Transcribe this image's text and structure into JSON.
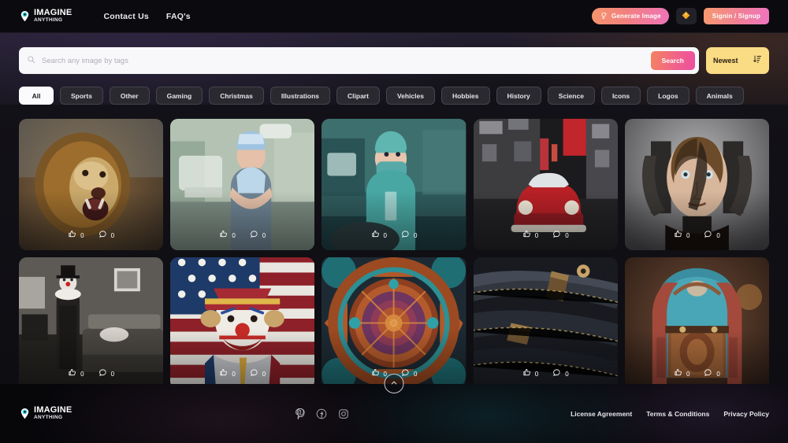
{
  "header": {
    "logo": {
      "icon": "lightbulb-pin-icon",
      "top": "IMAGINE",
      "bottom": "ANYTHING",
      "accent": "#3fd6e0"
    },
    "nav": [
      {
        "label": "Contact Us",
        "name": "nav-contact-us"
      },
      {
        "label": "FAQ's",
        "name": "nav-faqs"
      }
    ],
    "generate_button": {
      "label": "Generate Image",
      "icon": "magic-lightbulb-icon"
    },
    "coin_button": {
      "icon": "coin-icon"
    },
    "signin_button": {
      "label": "Signin / Signup"
    }
  },
  "search": {
    "placeholder": "Search any image by tags",
    "value": "",
    "icon": "search-icon",
    "button_label": "Search",
    "sort": {
      "value": "Newest",
      "icon": "sort-descending-icon"
    }
  },
  "categories": [
    {
      "label": "All",
      "active": true
    },
    {
      "label": "Sports",
      "active": false
    },
    {
      "label": "Other",
      "active": false
    },
    {
      "label": "Gaming",
      "active": false
    },
    {
      "label": "Christmas",
      "active": false
    },
    {
      "label": "Illustrations",
      "active": false
    },
    {
      "label": "Clipart",
      "active": false
    },
    {
      "label": "Vehicles",
      "active": false
    },
    {
      "label": "Hobbies",
      "active": false
    },
    {
      "label": "History",
      "active": false
    },
    {
      "label": "Science",
      "active": false
    },
    {
      "label": "Icons",
      "active": false
    },
    {
      "label": "Logos",
      "active": false
    },
    {
      "label": "Animals",
      "active": false
    }
  ],
  "gallery": {
    "like_icon": "thumbs-up-icon",
    "comment_icon": "comment-bubble-icon",
    "items": [
      {
        "subject": "roaring lion",
        "likes": "0",
        "comments": "0"
      },
      {
        "subject": "nurse in operating room",
        "likes": "0",
        "comments": "0"
      },
      {
        "subject": "surgeon in teal scrubs",
        "likes": "0",
        "comments": "0"
      },
      {
        "subject": "red classic car on street",
        "likes": "0",
        "comments": "0"
      },
      {
        "subject": "cyborg woman portrait",
        "likes": "0",
        "comments": "0"
      },
      {
        "subject": "clown in bedroom black and white",
        "likes": "0",
        "comments": "0"
      },
      {
        "subject": "clown with american flag",
        "likes": "0",
        "comments": "0"
      },
      {
        "subject": "ornate mandala pattern",
        "likes": "0",
        "comments": "0"
      },
      {
        "subject": "rolled denim jeans",
        "likes": "0",
        "comments": "0"
      },
      {
        "subject": "teal and red backpack",
        "likes": "0",
        "comments": "0"
      }
    ]
  },
  "footer": {
    "logo": {
      "top": "IMAGINE",
      "bottom": "ANYTHING"
    },
    "social": [
      {
        "name": "pinterest-icon"
      },
      {
        "name": "facebook-icon"
      },
      {
        "name": "instagram-icon"
      }
    ],
    "links": [
      {
        "label": "License Agreement"
      },
      {
        "label": "Terms & Conditions"
      },
      {
        "label": "Privacy Policy"
      }
    ],
    "scroll_top_icon": "chevron-up-icon"
  }
}
